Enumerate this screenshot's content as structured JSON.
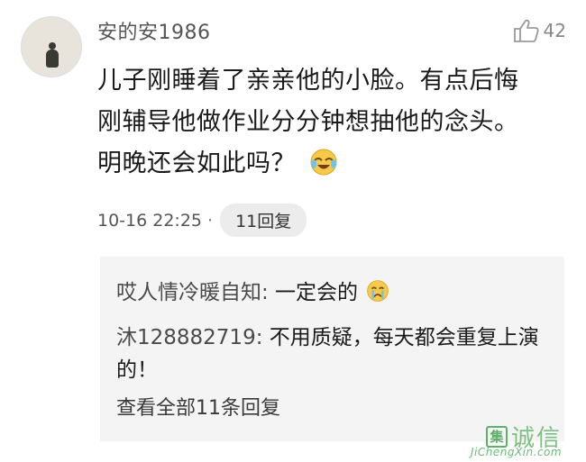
{
  "comment": {
    "username": "安的安1986",
    "like_count": "42",
    "text_lines": [
      "儿子刚睡着了亲亲他的小脸。有点后悔",
      "刚辅导他做作业分分钟想抽他的念头。",
      "明晚还会如此吗？"
    ],
    "time": "10-16 22:25",
    "separator": "·",
    "reply_button": "11回复"
  },
  "replies": {
    "items": [
      {
        "user": "哎人情冷暖自知:",
        "text": " 一定会的"
      },
      {
        "user": "沐128882719:",
        "text": " 不用质疑，每天都会重复上演的！"
      }
    ],
    "view_all": "查看全部11条回复"
  },
  "watermark": {
    "logo_char": "集",
    "name": "诚信",
    "url": "JiChengXin.com"
  },
  "colors": {
    "accent_green": "#5fb06a",
    "reply_bg": "#f4f4f4",
    "pill_bg": "#ececec"
  },
  "icons": [
    "thumbs-up-icon",
    "crying-laughing-emoji",
    "crying-emoji"
  ]
}
